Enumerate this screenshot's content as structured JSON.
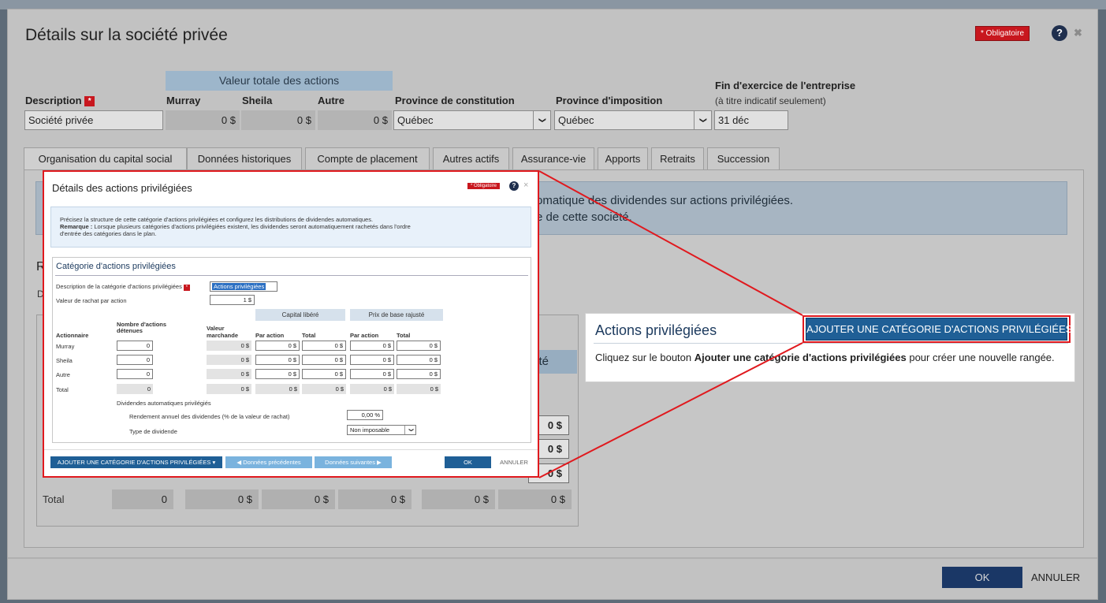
{
  "dialog": {
    "title": "Détails sur la société privée",
    "required_badge": "* Obligatoire",
    "help_glyph": "?",
    "close_glyph": "✖",
    "ok_label": "OK",
    "cancel_label": "ANNULER"
  },
  "header": {
    "valeur_totale": "Valeur totale des actions",
    "description_label": "Description",
    "required_marker": "*",
    "murray_label": "Murray",
    "sheila_label": "Sheila",
    "autre_label": "Autre",
    "province_constitution_label": "Province de constitution",
    "province_imposition_label": "Province d'imposition",
    "fin_exercice_label": "Fin d'exercice de l'entreprise",
    "fin_exercice_sub": "(à titre indicatif seulement)",
    "description_value": "Société privée",
    "murray_value": "0 $",
    "sheila_value": "0 $",
    "autre_value": "0 $",
    "province_constitution_value": "Québec",
    "province_imposition_value": "Québec",
    "fin_exercice_value": "31 déc",
    "chevron_glyph": "❯"
  },
  "tabs": [
    {
      "label": "Organisation du capital social"
    },
    {
      "label": "Données historiques"
    },
    {
      "label": "Compte de placement"
    },
    {
      "label": "Autres actifs"
    },
    {
      "label": "Assurance-vie"
    },
    {
      "label": "Apports"
    },
    {
      "label": "Retraits"
    },
    {
      "label": "Succession"
    }
  ],
  "info": {
    "line1": "omatique des dividendes sur actions privilégiées.",
    "line2": "e de cette société."
  },
  "partial": {
    "r": "R",
    "d": "D",
    "a": "A",
    "ste": "sté"
  },
  "totals": {
    "label": "Total",
    "values": [
      "0",
      "0 $",
      "0 $",
      "0 $",
      "0 $",
      "0 $"
    ],
    "right_vals": [
      "0 $",
      "0 $",
      "0 $"
    ]
  },
  "card": {
    "title": "Actions privilégiées",
    "add_button": "AJOUTER UNE CATÉGORIE D'ACTIONS PRIVILÉGIÉES",
    "text_prefix": "Cliquez sur le bouton",
    "text_bold": "Ajouter une catégorie d'actions privilégiées",
    "text_suffix": "pour créer une nouvelle rangée."
  },
  "inset": {
    "title": "Détails des actions privilégiées",
    "required_badge": "* Obligatoire",
    "help_glyph": "?",
    "close_glyph": "×",
    "note_line1": "Précisez la structure de cette catégorie d'actions privilégiées et configurez les distributions de dividendes automatiques.",
    "note_remark_label": "Remarque :",
    "note_line2": "Lorsque plusieurs catégories d'actions privilégiées existent, les dividendes seront automatiquement rachetés dans l'ordre",
    "note_line3": "d'entrée des catégories dans le plan.",
    "cat_title": "Catégorie d'actions privilégiées",
    "desc_label": "Description de la catégorie d'actions privilégiées",
    "required_marker": "*",
    "desc_value": "Actions privilégiées",
    "rachat_label": "Valeur de rachat par action",
    "rachat_value": "1 $",
    "capital_libere": "Capital libéré",
    "prix_base": "Prix de base rajusté",
    "col_actionnaire": "Actionnaire",
    "col_nombre_1": "Nombre d'actions",
    "col_nombre_2": "détenues",
    "col_valeur_1": "Valeur",
    "col_valeur_2": "marchande",
    "col_par_action": "Par action",
    "col_total": "Total",
    "rows": [
      {
        "name": "Murray",
        "nombre": "0",
        "valeur": "0 $",
        "cl_pa": "0 $",
        "cl_t": "0 $",
        "pb_pa": "0 $",
        "pb_t": "0 $"
      },
      {
        "name": "Sheila",
        "nombre": "0",
        "valeur": "0 $",
        "cl_pa": "0 $",
        "cl_t": "0 $",
        "pb_pa": "0 $",
        "pb_t": "0 $"
      },
      {
        "name": "Autre",
        "nombre": "0",
        "valeur": "0 $",
        "cl_pa": "0 $",
        "cl_t": "0 $",
        "pb_pa": "0 $",
        "pb_t": "0 $"
      },
      {
        "name": "Total",
        "nombre": "0",
        "valeur": "0 $",
        "cl_pa": "0 $",
        "cl_t": "0 $",
        "pb_pa": "0 $",
        "pb_t": "0 $"
      }
    ],
    "div_auto_label": "Dividendes automatiques privilégiés",
    "rendement_label": "Rendement annuel des dividendes (% de la valeur de rachat)",
    "rendement_value": "0,00 %",
    "type_label": "Type de dividende",
    "type_value": "Non imposable",
    "chevron_glyph": "❯",
    "add_button": "AJOUTER UNE CATÉGORIE D'ACTIONS PRIVILÉGIÉES",
    "add_caret": "▾",
    "prev_button": "Données précédentes",
    "prev_glyph": "◀",
    "next_button": "Données suivantes",
    "next_glyph": "▶",
    "ok_label": "OK",
    "cancel_label": "ANNULER"
  },
  "colors": {
    "accent": "#1f5f96",
    "required": "#c8171e",
    "highlight": "#e0191e",
    "ok_button": "#1a3766"
  }
}
